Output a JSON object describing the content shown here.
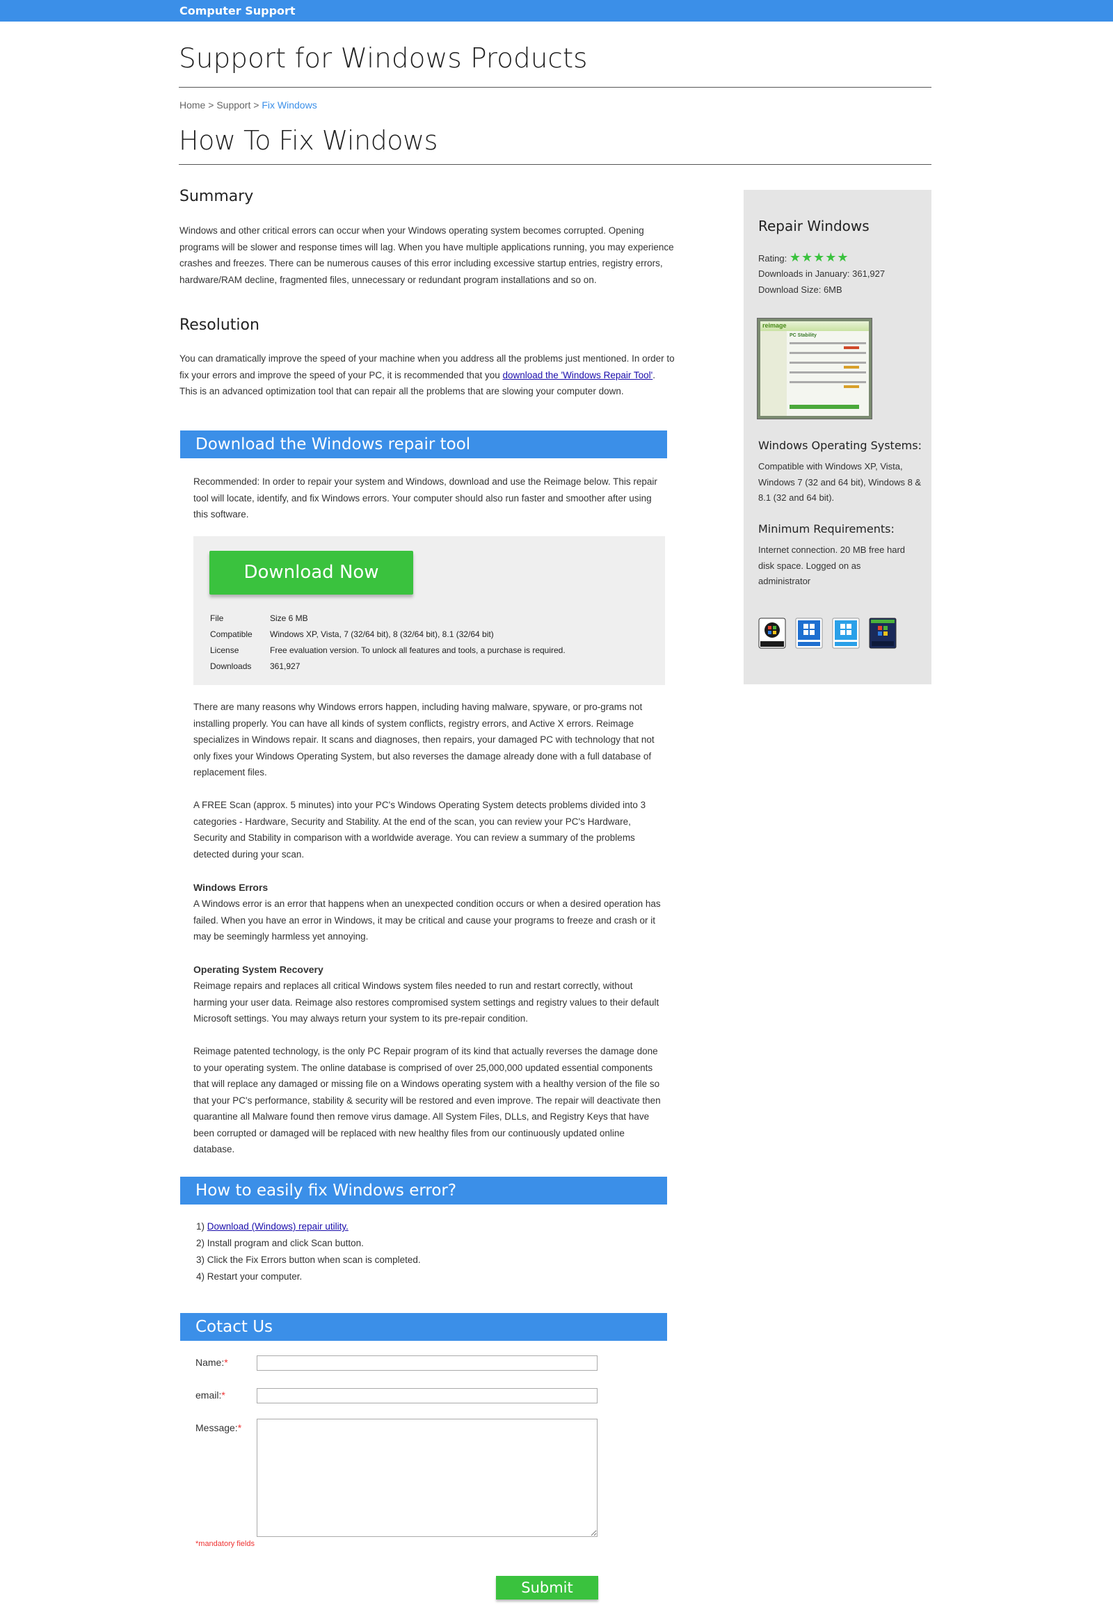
{
  "header": {
    "brand": "Computer Support"
  },
  "page_title": "Support for Windows Products",
  "breadcrumb": {
    "home": "Home",
    "sep": ">",
    "support": "Support",
    "current": "Fix Windows"
  },
  "headline": "How To Fix Windows",
  "summary": {
    "title": "Summary",
    "text": "Windows and other critical errors can occur when your Windows operating system becomes corrupted. Opening programs will be slower and response times will lag. When you have multiple applications running, you may experience crashes and freezes. There can be numerous causes of this error including excessive startup entries, registry errors, hardware/RAM decline, fragmented files, unnecessary or redundant program installations and so on."
  },
  "resolution": {
    "title": "Resolution",
    "text_before": "You can dramatically improve the speed of your machine when you address all the problems just mentioned. In order to fix your errors and improve the speed of your PC, it is recommended that you ",
    "link": "download the 'Windows Repair Tool'",
    "text_after": ". This is an advanced optimization tool that can repair all the problems that are slowing your computer down."
  },
  "download_section": {
    "title": "Download the Windows repair tool",
    "recommended": "Recommended: In order to repair your system and Windows, download and use the Reimage below. This repair tool will locate, identify, and fix Windows errors. Your computer should also run faster and smoother after using this software.",
    "button": "Download Now",
    "specs": [
      {
        "key": "File",
        "value": "Size 6 MB"
      },
      {
        "key": "Compatible",
        "value": "Windows XP, Vista, 7 (32/64 bit), 8 (32/64 bit), 8.1 (32/64 bit)"
      },
      {
        "key": "License",
        "value": "Free evaluation version. To unlock all features and tools, a purchase is required."
      },
      {
        "key": "Downloads",
        "value": "361,927"
      }
    ]
  },
  "body": {
    "p1": "There are many reasons why Windows errors happen, including having malware, spyware, or pro-grams not installing properly. You can have all kinds of system conflicts, registry errors, and Active X errors. Reimage specializes in Windows repair. It scans and diagnoses, then repairs, your damaged PC with technology that not only fixes your Windows Operating System, but also reverses the damage already done with a full database of replacement files.",
    "p2": "A FREE Scan (approx. 5 minutes) into your PC's Windows Operating System detects problems divided into 3 categories - Hardware, Security and Stability. At the end of the scan, you can review your PC's Hardware, Security and Stability in comparison with a worldwide average. You can review a summary of the problems detected during your scan.",
    "h_errors": "Windows Errors",
    "p3": "A Windows error is an error that happens when an unexpected condition occurs or when a desired operation has failed. When you have an error in Windows, it may be critical and cause your programs to freeze and crash or it may be seemingly harmless yet annoying.",
    "h_recovery": "Operating System Recovery",
    "p4": "Reimage repairs and replaces all critical Windows system files needed to run and restart correctly, without harming your user data. Reimage also restores compromised system settings and registry values to their default Microsoft settings. You may always return your system to its pre-repair condition.",
    "p5": "Reimage patented technology, is the only PC Repair program of its kind that actually reverses the damage done to your operating system. The online database is comprised of over 25,000,000 updated essential components that will replace any damaged or missing file on a Windows operating system with a healthy version of the file so that your PC's performance, stability & security will be restored and even improve. The repair will deactivate then quarantine all Malware found then remove virus damage. All System Files, DLLs, and Registry Keys that have been corrupted or damaged will be replaced with new healthy files from our continuously updated online database."
  },
  "howto": {
    "title": "How to easily fix Windows error?",
    "step1_num": "1)",
    "step1_link": "Download (Windows) repair utility.",
    "step2": "2) Install program and click Scan button.",
    "step3": "3) Click the Fix Errors button when scan is completed.",
    "step4": "4) Restart your computer."
  },
  "contact": {
    "title": "Cotact Us",
    "name_label": "Name:",
    "email_label": "email:",
    "message_label": "Message:",
    "required_mark": "*",
    "mandatory": "*mandatory fields",
    "submit": "Submit"
  },
  "sidebar": {
    "title": "Repair Windows",
    "rating_label": "Rating:",
    "rating_stars": "★★★★★",
    "rating_value": 5,
    "downloads": "Downloads in January: 361,927",
    "size": "Download Size: 6MB",
    "os_title": "Windows Operating Systems:",
    "os_text": "Compatible with Windows XP, Vista, Windows 7 (32 and 64 bit), Windows 8 & 8.1 (32 and 64 bit).",
    "req_title": "Minimum Requirements:",
    "req_text": "Internet connection. 20 MB free hard disk space. Logged on as administrator",
    "logo_text": "reimage",
    "screen_title": "PC Stability"
  },
  "colors": {
    "accent": "#3b8fe8",
    "green": "#3ac23e",
    "sidebar_bg": "#e5e5e5"
  }
}
